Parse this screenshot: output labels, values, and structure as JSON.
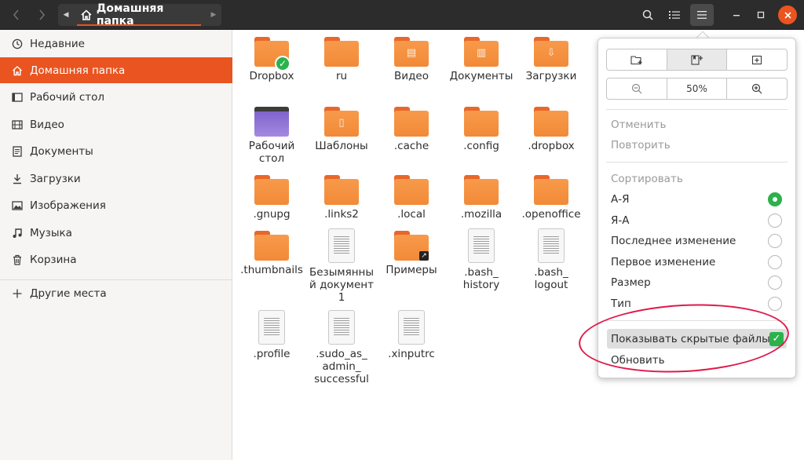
{
  "header": {
    "path_label": "Домашняя папка",
    "back_icon": "chevron-left-icon",
    "forward_icon": "chevron-right-icon",
    "home_icon": "home-icon"
  },
  "sidebar": {
    "items": [
      {
        "label": "Недавние",
        "icon": "clock-icon"
      },
      {
        "label": "Домашняя папка",
        "icon": "home-icon"
      },
      {
        "label": "Рабочий стол",
        "icon": "desktop-icon"
      },
      {
        "label": "Видео",
        "icon": "video-icon"
      },
      {
        "label": "Документы",
        "icon": "document-icon"
      },
      {
        "label": "Загрузки",
        "icon": "download-icon"
      },
      {
        "label": "Изображения",
        "icon": "image-icon"
      },
      {
        "label": "Музыка",
        "icon": "music-icon"
      },
      {
        "label": "Корзина",
        "icon": "trash-icon"
      },
      {
        "label": "Другие места",
        "icon": "plus-icon"
      }
    ]
  },
  "files": [
    {
      "name": "Dropbox",
      "kind": "folder"
    },
    {
      "name": "ru",
      "kind": "folder"
    },
    {
      "name": "Видео",
      "kind": "folder"
    },
    {
      "name": "Документы",
      "kind": "folder"
    },
    {
      "name": "Загрузки",
      "kind": "folder"
    },
    {
      "name": "Рабочий стол",
      "kind": "desktop"
    },
    {
      "name": "Шаблоны",
      "kind": "folder"
    },
    {
      "name": ".cache",
      "kind": "folder"
    },
    {
      "name": ".config",
      "kind": "folder"
    },
    {
      "name": ".dropbox",
      "kind": "folder"
    },
    {
      "name": ".gnupg",
      "kind": "folder"
    },
    {
      "name": ".links2",
      "kind": "folder"
    },
    {
      "name": ".local",
      "kind": "folder"
    },
    {
      "name": ".mozilla",
      "kind": "folder"
    },
    {
      "name": ".openoffice",
      "kind": "folder"
    },
    {
      "name": ".thumbnails",
      "kind": "folder"
    },
    {
      "name": "Безымянный документ 1",
      "kind": "document"
    },
    {
      "name": "Примеры",
      "kind": "folder-link"
    },
    {
      "name": ".bash_ history",
      "kind": "document"
    },
    {
      "name": ".bash_ logout",
      "kind": "document"
    },
    {
      "name": ".profile",
      "kind": "document"
    },
    {
      "name": ".sudo_as_ admin_ successful",
      "kind": "document"
    },
    {
      "name": ".xinputrc",
      "kind": "document"
    }
  ],
  "menu": {
    "zoom_value": "50%",
    "undo": "Отменить",
    "redo": "Повторить",
    "sort_heading": "Сортировать",
    "sort_options": [
      {
        "label": "А-Я",
        "selected": true
      },
      {
        "label": "Я-А",
        "selected": false
      },
      {
        "label": "Последнее изменение",
        "selected": false
      },
      {
        "label": "Первое изменение",
        "selected": false
      },
      {
        "label": "Размер",
        "selected": false
      },
      {
        "label": "Тип",
        "selected": false
      }
    ],
    "show_hidden": "Показывать скрытые файлы",
    "show_hidden_checked": true,
    "refresh": "Обновить"
  },
  "colors": {
    "accent": "#e95420",
    "check": "#2bb24c",
    "annotation": "#e0194a"
  }
}
